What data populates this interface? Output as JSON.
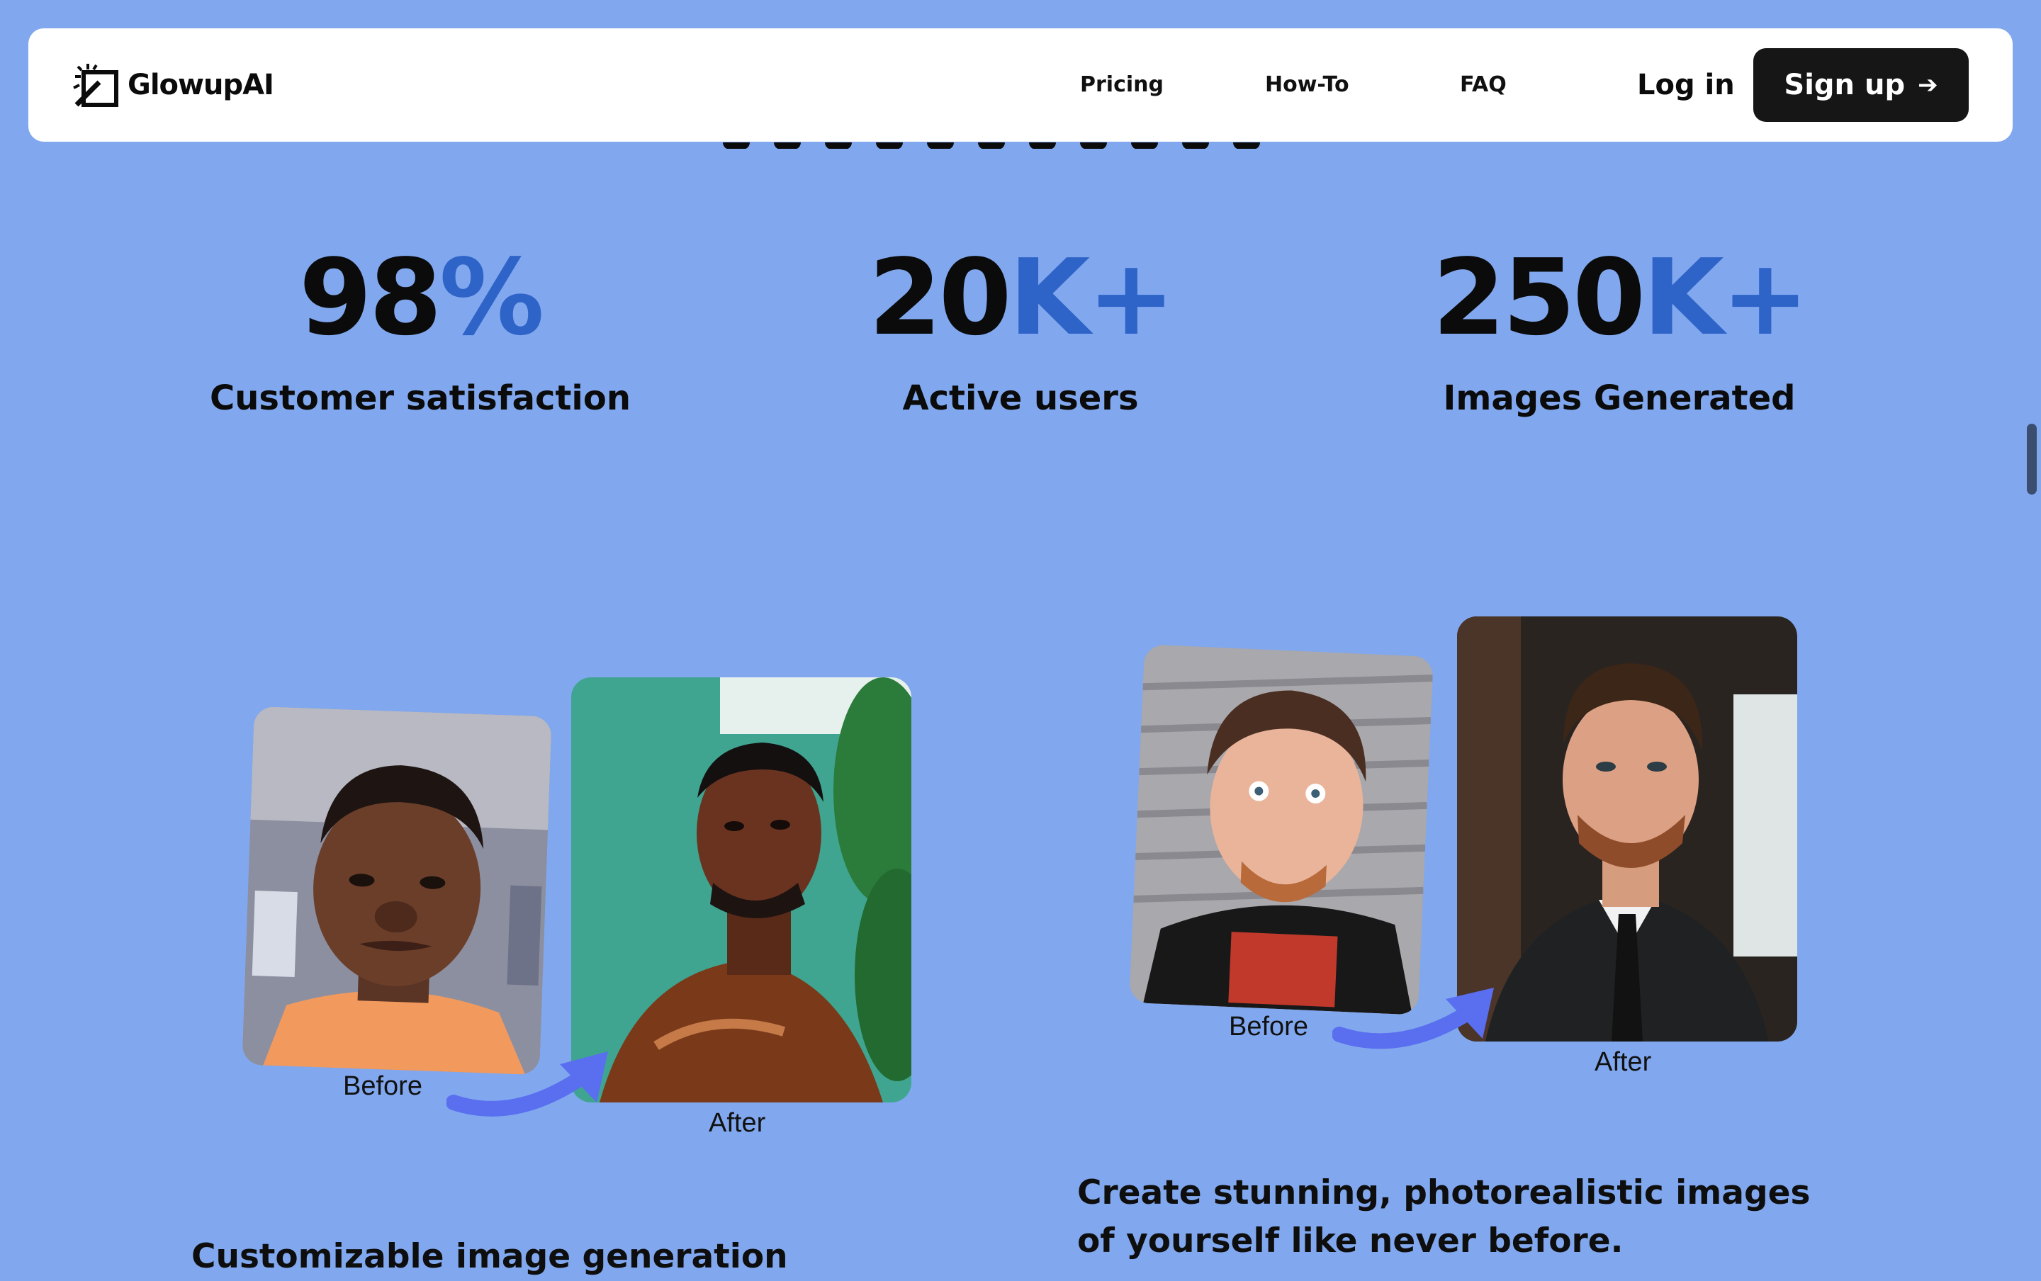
{
  "nav": {
    "brand": "GlowupAI",
    "links": [
      "Pricing",
      "How-To",
      "FAQ"
    ],
    "login_label": "Log in",
    "signup_label": "Sign up",
    "signup_icon": "arrow-right-icon"
  },
  "stats": [
    {
      "number": "98",
      "suffix": "%",
      "label": "Customer satisfaction"
    },
    {
      "number": "20",
      "suffix": "K+",
      "label": "Active users"
    },
    {
      "number": "250",
      "suffix": "K+",
      "label": "Images Generated"
    }
  ],
  "showcase": [
    {
      "before_label": "Before",
      "after_label": "After",
      "description": "Customizable image generation"
    },
    {
      "before_label": "Before",
      "after_label": "After",
      "description": "Create stunning, photorealistic images of yourself like never before."
    }
  ],
  "colors": {
    "background": "#81a8ee",
    "accent": "#2e63c8",
    "button": "#161616",
    "arrow": "#5a6ef0"
  }
}
